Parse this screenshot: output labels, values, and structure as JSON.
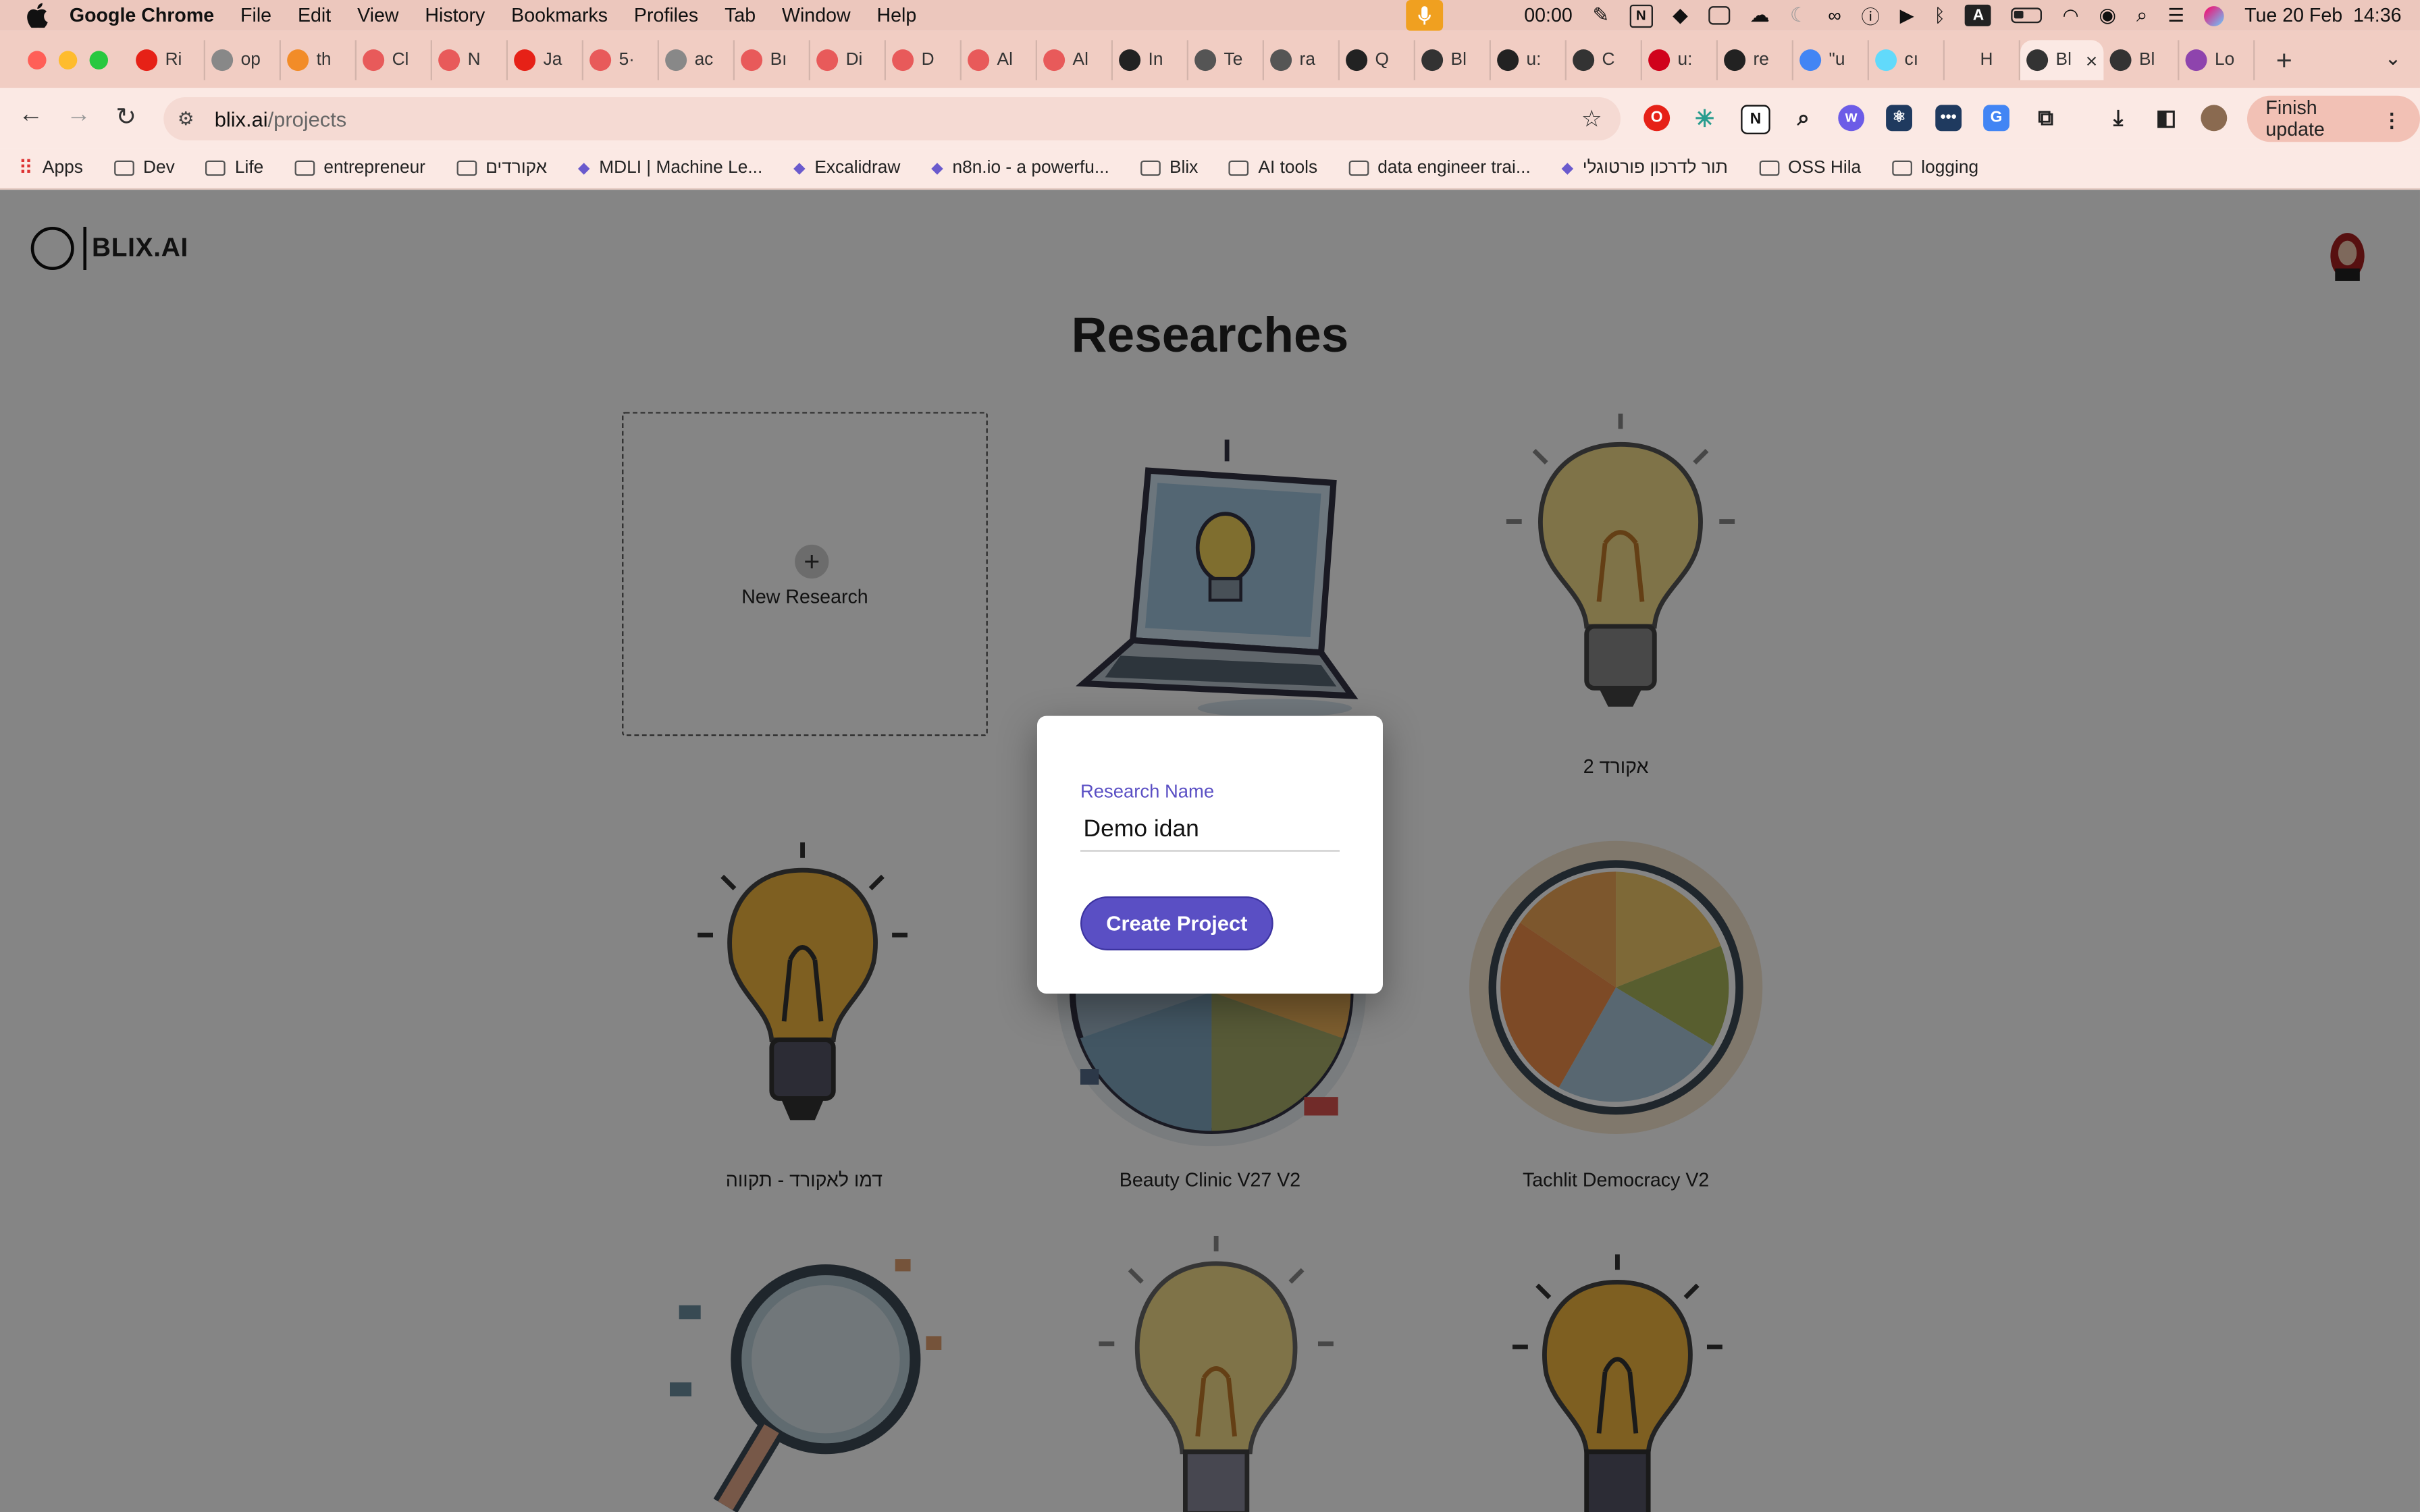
{
  "menubar": {
    "app_name": "Google Chrome",
    "items": [
      "File",
      "Edit",
      "View",
      "History",
      "Bookmarks",
      "Profiles",
      "Tab",
      "Window",
      "Help"
    ],
    "timer": "00:00",
    "keyboard_indicator": "A",
    "datetime": "Tue 20 Feb  14:36"
  },
  "tabs": [
    {
      "label": "Ri",
      "icon": "youtube-icon",
      "color": "#e62117"
    },
    {
      "label": "op",
      "icon": "openai-icon",
      "color": "#888888"
    },
    {
      "label": "th",
      "icon": "app-icon",
      "color": "#f28c28"
    },
    {
      "label": "Cl",
      "icon": "perplexity-icon",
      "color": "#e85a5a"
    },
    {
      "label": "N",
      "icon": "perplexity-icon",
      "color": "#e85a5a"
    },
    {
      "label": "Ja",
      "icon": "youtube-icon",
      "color": "#e62117"
    },
    {
      "label": "5·",
      "icon": "perplexity-icon",
      "color": "#e85a5a"
    },
    {
      "label": "ac",
      "icon": "openai-icon",
      "color": "#888888"
    },
    {
      "label": "Bı",
      "icon": "perplexity-icon",
      "color": "#e85a5a"
    },
    {
      "label": "Di",
      "icon": "perplexity-icon",
      "color": "#e85a5a"
    },
    {
      "label": "D",
      "icon": "perplexity-icon",
      "color": "#e85a5a"
    },
    {
      "label": "Al",
      "icon": "perplexity-icon",
      "color": "#e85a5a"
    },
    {
      "label": "Al",
      "icon": "perplexity-icon",
      "color": "#e85a5a"
    },
    {
      "label": "In",
      "icon": "app-icon",
      "color": "#222222"
    },
    {
      "label": "Te",
      "icon": "app-icon",
      "color": "#555555"
    },
    {
      "label": "ra",
      "icon": "app-icon",
      "color": "#555555"
    },
    {
      "label": "Q",
      "icon": "app-icon",
      "color": "#222222"
    },
    {
      "label": "Bl",
      "icon": "blix-icon",
      "color": "#333333"
    },
    {
      "label": "u:",
      "icon": "github-icon",
      "color": "#222222"
    },
    {
      "label": "C",
      "icon": "app-icon",
      "color": "#333333"
    },
    {
      "label": "u:",
      "icon": "app-icon",
      "color": "#d0021b"
    },
    {
      "label": "re",
      "icon": "github-icon",
      "color": "#222222"
    },
    {
      "label": "\"u",
      "icon": "google-icon",
      "color": "#4285f4"
    },
    {
      "label": "cı",
      "icon": "react-icon",
      "color": "#61dafb"
    },
    {
      "label": "H",
      "icon": "blank-icon",
      "color": "#f1cdc3"
    },
    {
      "label": "Bl",
      "icon": "blix-icon",
      "color": "#333333",
      "active": true
    },
    {
      "label": "Bl",
      "icon": "blix-icon",
      "color": "#333333"
    },
    {
      "label": "Lo",
      "icon": "app-icon",
      "color": "#8e44ad"
    }
  ],
  "toolbar": {
    "url_domain": "blix.ai",
    "url_path": "/projects",
    "finish_update": "Finish update"
  },
  "bookmarks": [
    {
      "label": "Apps",
      "type": "apps"
    },
    {
      "label": "Dev",
      "type": "folder"
    },
    {
      "label": "Life",
      "type": "folder"
    },
    {
      "label": "entrepreneur",
      "type": "folder"
    },
    {
      "label": "אקורדים",
      "type": "folder"
    },
    {
      "label": "MDLI | Machine Le...",
      "type": "site"
    },
    {
      "label": "Excalidraw",
      "type": "site"
    },
    {
      "label": "n8n.io - a powerfu...",
      "type": "site"
    },
    {
      "label": "Blix",
      "type": "folder"
    },
    {
      "label": "AI tools",
      "type": "folder"
    },
    {
      "label": "data engineer trai...",
      "type": "folder"
    },
    {
      "label": "תור לדרכון פורטוגלי",
      "type": "site"
    },
    {
      "label": "OSS Hila",
      "type": "folder"
    },
    {
      "label": "logging",
      "type": "folder"
    }
  ],
  "page": {
    "logo_text": "BLIX.AI",
    "title": "Researches",
    "new_research_label": "New Research",
    "projects": [
      {
        "name": "",
        "image": "laptop-lightbulb-icon"
      },
      {
        "name": "2 אקורד",
        "image": "lightbulb-icon"
      },
      {
        "name": "דמו לאקורד - תקווה",
        "image": "lightbulb-icon"
      },
      {
        "name": "Beauty Clinic V27 V2",
        "image": "pie-chart-icon"
      },
      {
        "name": "Tachlit Democracy V2",
        "image": "pie-chart-icon"
      },
      {
        "name": "",
        "image": "magnifier-icon"
      },
      {
        "name": "",
        "image": "lightbulb-icon"
      },
      {
        "name": "",
        "image": "lightbulb-icon"
      }
    ]
  },
  "dialog": {
    "field_label": "Research Name",
    "field_value": "Demo idan",
    "submit_label": "Create Project",
    "accent": "#5a4fc4"
  }
}
